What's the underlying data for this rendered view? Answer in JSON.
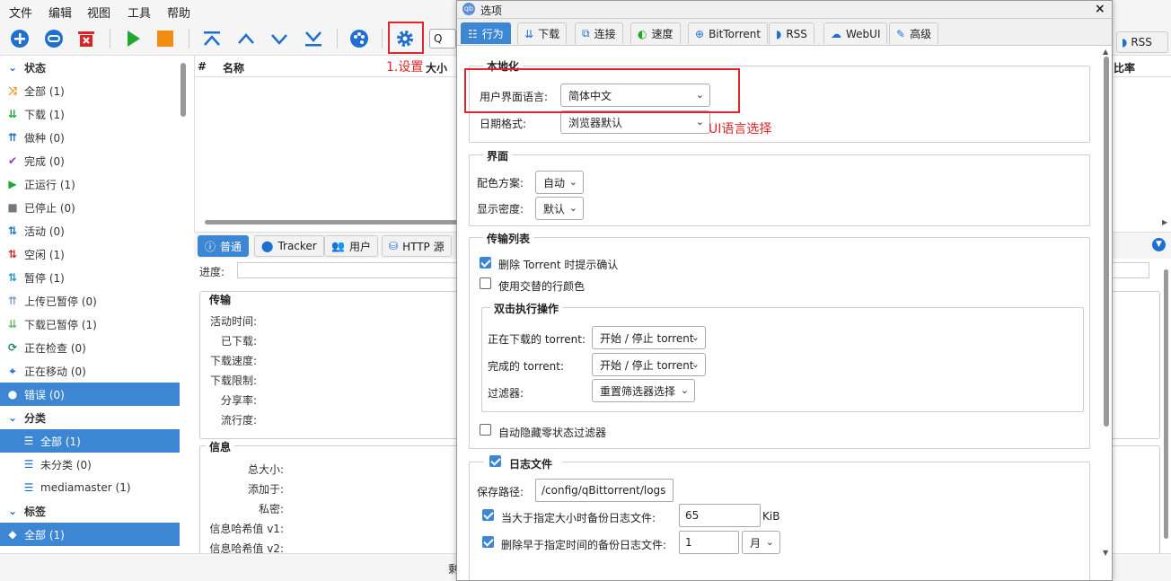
{
  "menubar": {
    "file": "文件",
    "edit": "编辑",
    "view": "视图",
    "tools": "工具",
    "help": "帮助"
  },
  "toolbar": {
    "search_partial": "Q 过",
    "rss_label": "RSS"
  },
  "sidebar": {
    "status_header": "状态",
    "status_items": [
      {
        "label": "全部 (1)"
      },
      {
        "label": "下载 (1)"
      },
      {
        "label": "做种 (0)"
      },
      {
        "label": "完成 (0)"
      },
      {
        "label": "正运行 (1)"
      },
      {
        "label": "已停止 (0)"
      },
      {
        "label": "活动 (0)"
      },
      {
        "label": "空闲 (1)"
      },
      {
        "label": "暂停 (1)"
      },
      {
        "label": "上传已暂停 (0)"
      },
      {
        "label": "下载已暂停 (1)"
      },
      {
        "label": "正在检查 (0)"
      },
      {
        "label": "正在移动 (0)"
      },
      {
        "label": "错误 (0)"
      }
    ],
    "category_header": "分类",
    "category_items": [
      {
        "label": "全部 (1)"
      },
      {
        "label": "未分类 (0)"
      },
      {
        "label": "mediamaster (1)"
      }
    ],
    "tags_header": "标签",
    "tag_items": [
      {
        "label": "全部 (1)"
      }
    ]
  },
  "list": {
    "col_hash": "#",
    "col_name": "名称",
    "col_size": "大小",
    "col_ratio": "比率"
  },
  "panel": {
    "tabs": [
      "普通",
      "Tracker",
      "用户",
      "HTTP 源"
    ],
    "progress_label": "进度:",
    "transfer_title": "传输",
    "transfer_labels": [
      "活动时间:",
      "已下载:",
      "下载速度:",
      "下载限制:",
      "分享率:",
      "流行度:"
    ],
    "info_title": "信息",
    "info_labels": [
      "总大小:",
      "添加于:",
      "私密:",
      "信息哈希值 v1:",
      "信息哈希值 v2:"
    ]
  },
  "statusbar": {
    "text": "剩"
  },
  "annotations": {
    "settings_note": "1.设置",
    "language_note": "UI语言选择"
  },
  "dialog": {
    "title": "选项",
    "tabs": [
      {
        "label": "行为",
        "icon": "sliders-icon"
      },
      {
        "label": "下载",
        "icon": "download-icon"
      },
      {
        "label": "连接",
        "icon": "network-icon"
      },
      {
        "label": "速度",
        "icon": "gauge-icon"
      },
      {
        "label": "BitTorrent",
        "icon": "globe-icon"
      },
      {
        "label": "RSS",
        "icon": "rss-icon"
      },
      {
        "label": "WebUI",
        "icon": "cloud-icon"
      },
      {
        "label": "高级",
        "icon": "wrench-icon"
      }
    ],
    "localization": {
      "title": "本地化",
      "ui_language_label": "用户界面语言:",
      "ui_language_value": "简体中文",
      "date_format_label": "日期格式:",
      "date_format_value": "浏览器默认"
    },
    "interface": {
      "title": "界面",
      "color_scheme_label": "配色方案:",
      "color_scheme_value": "自动",
      "density_label": "显示密度:",
      "density_value": "默认"
    },
    "transfer_list": {
      "title": "传输列表",
      "confirm_delete": {
        "label": "删除 Torrent 时提示确认",
        "checked": true
      },
      "alt_row_colors": {
        "label": "使用交替的行颜色",
        "checked": false
      },
      "double_click": {
        "title": "双击执行操作",
        "downloading_label": "正在下载的 torrent:",
        "downloading_value": "开始 / 停止 torrent",
        "completed_label": "完成的 torrent:",
        "completed_value": "开始 / 停止 torrent",
        "filter_label": "过滤器:",
        "filter_value": "重置筛选器选择"
      },
      "hide_zero_filters": {
        "label": "自动隐藏零状态过滤器",
        "checked": false
      }
    },
    "log_file": {
      "title": "日志文件",
      "enabled": true,
      "save_path_label": "保存路径:",
      "save_path_value": "/config/qBittorrent/logs",
      "backup_size": {
        "label": "当大于指定大小时备份日志文件:",
        "value": "65",
        "unit": "KiB",
        "checked": true
      },
      "delete_old": {
        "label": "删除早于指定时间的备份日志文件:",
        "value": "1",
        "unit": "月",
        "checked": true
      }
    }
  },
  "colors": {
    "accent": "#3d86d4",
    "annotation": "#e0262a"
  }
}
